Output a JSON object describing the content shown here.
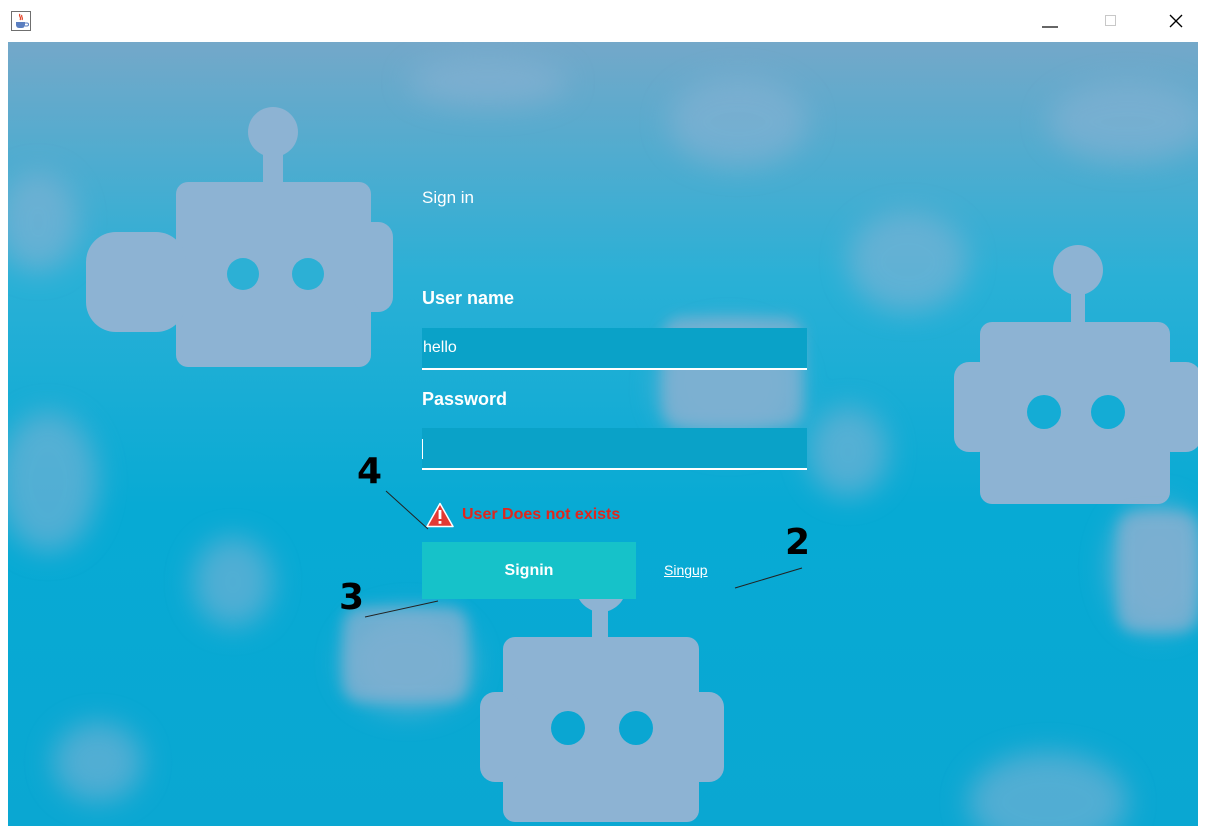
{
  "window": {
    "app_icon": "java-cup-icon",
    "controls": {
      "minimize_icon": "minimize-icon",
      "maximize_icon": "maximize-icon",
      "close_icon": "close-icon"
    }
  },
  "form": {
    "title": "Sign in",
    "username_label": "User name",
    "username_value": "hello",
    "password_label": "Password",
    "password_value": "",
    "error_icon": "warning-triangle-icon",
    "error_text": "User Does not exists",
    "signin_button": "Signin",
    "signup_link": "Singup"
  },
  "annotations": {
    "marker_2": "2",
    "marker_3": "3",
    "marker_4": "4"
  },
  "colors": {
    "background_top": "#74a8c9",
    "background_bottom": "#0aa7d2",
    "field_fill": "#0aa2c8",
    "button_fill": "#16c2c9",
    "error_text": "#e0261c",
    "robot_shape": "#8db3d3"
  },
  "decor": {
    "background_art": "robot-pattern"
  }
}
